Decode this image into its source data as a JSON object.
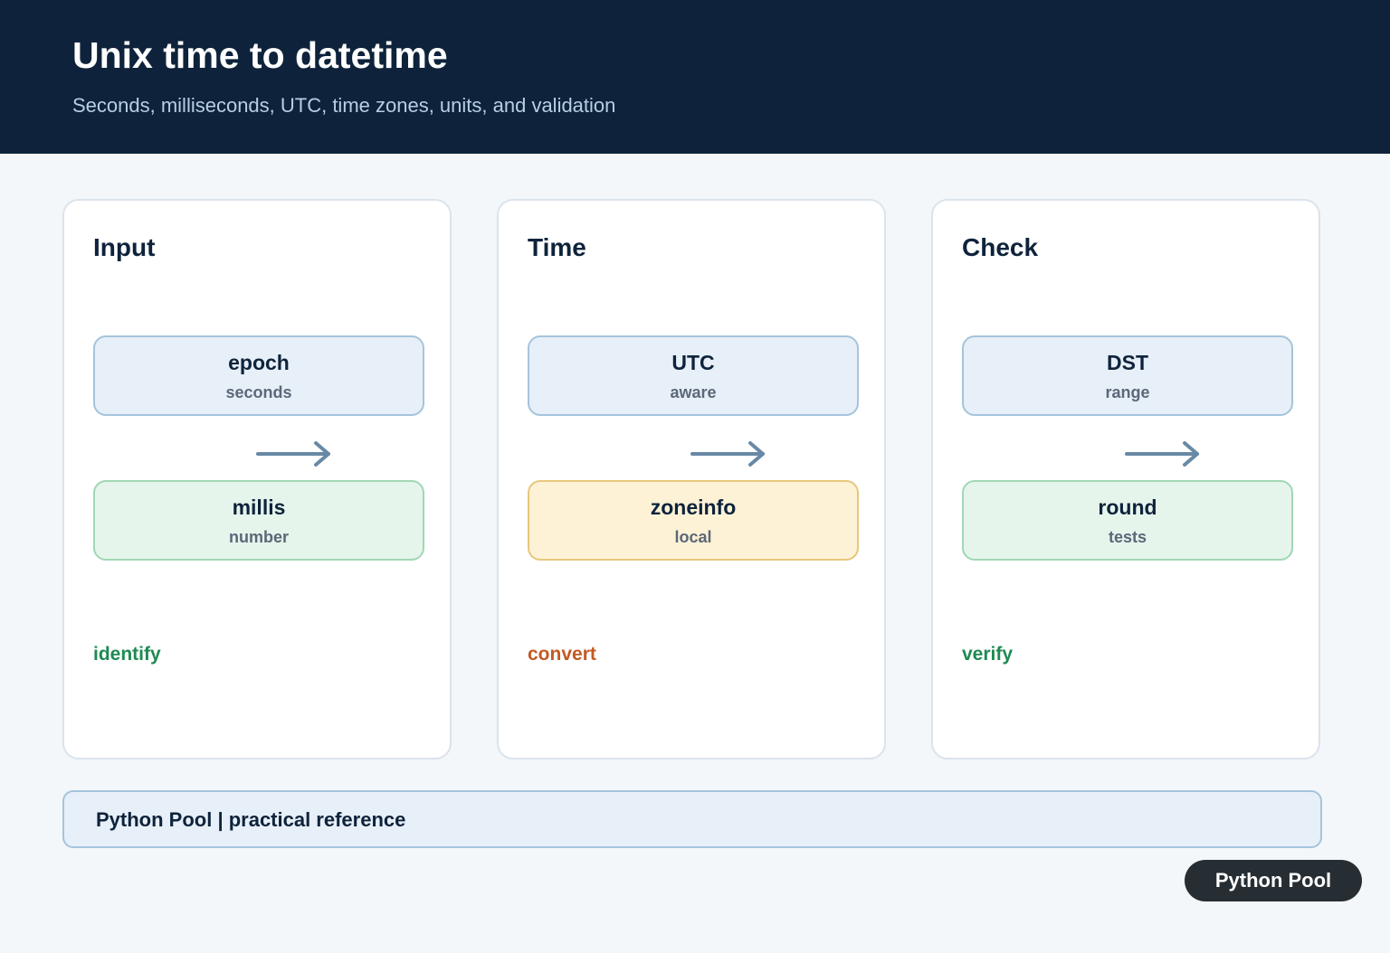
{
  "header": {
    "title": "Unix time to datetime",
    "subtitle": "Seconds, milliseconds, UTC, time zones, units, and validation"
  },
  "panels": [
    {
      "title": "Input",
      "top_node": {
        "label": "epoch",
        "sub": "seconds",
        "color": "#e7eff9"
      },
      "bottom_node": {
        "label": "millis",
        "sub": "number",
        "color": "#e6f5ec"
      },
      "action": {
        "text": "identify",
        "color": "#1e8a52"
      }
    },
    {
      "title": "Time",
      "top_node": {
        "label": "UTC",
        "sub": "aware",
        "color": "#e7eff9"
      },
      "bottom_node": {
        "label": "zoneinfo",
        "sub": "local",
        "color": "#fef2d6"
      },
      "action": {
        "text": "convert",
        "color": "#c25a22"
      }
    },
    {
      "title": "Check",
      "top_node": {
        "label": "DST",
        "sub": "range",
        "color": "#e7eff9"
      },
      "bottom_node": {
        "label": "round",
        "sub": "tests",
        "color": "#e6f5ec"
      },
      "action": {
        "text": "verify",
        "color": "#1e8a52"
      }
    }
  ],
  "arrow_color": "#6889a6",
  "footer": {
    "text": "Python Pool | practical reference"
  },
  "badge": {
    "text": "Python Pool"
  }
}
